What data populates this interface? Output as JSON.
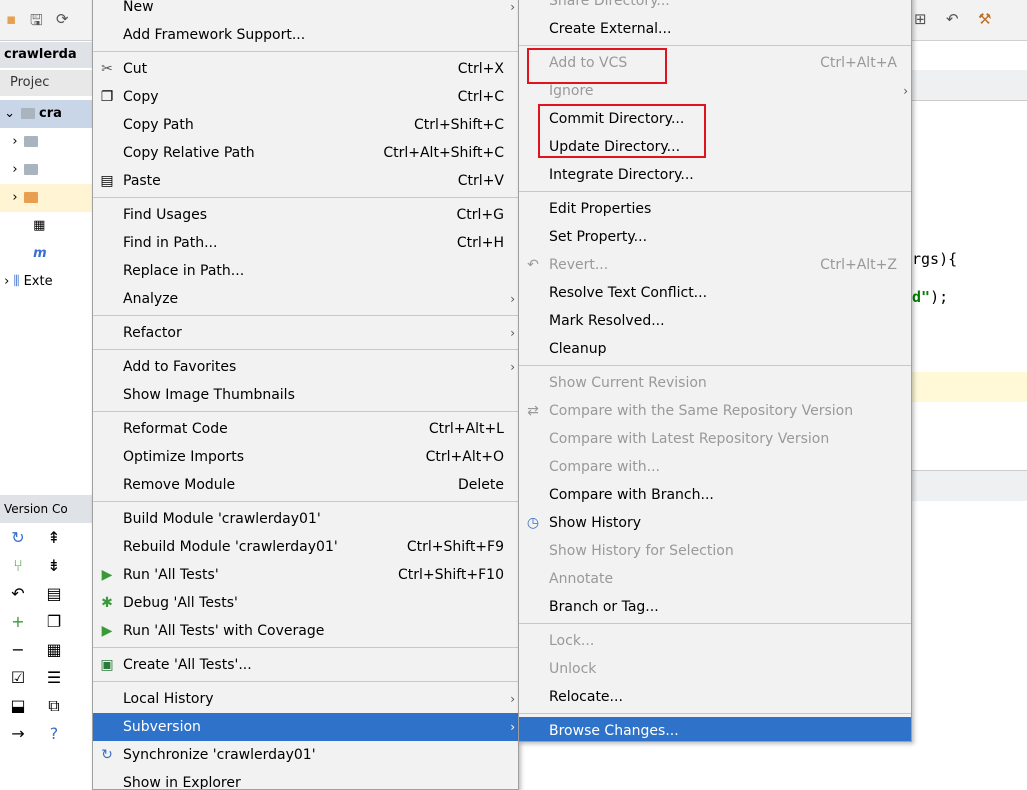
{
  "ide": {
    "project_title": "crawlerda",
    "project_tab": "Projec",
    "tree": [
      {
        "label": "cra",
        "type": "module"
      },
      {
        "label": "",
        "type": "folder"
      },
      {
        "label": "",
        "type": "folder"
      },
      {
        "label": "",
        "type": "folder-orange"
      },
      {
        "label": "",
        "type": "file"
      },
      {
        "label": "m",
        "type": "maven"
      },
      {
        "label": "Exte",
        "type": "libraries"
      }
    ],
    "code_line_1": "rgs){",
    "code_line_2_str": "d\"",
    "code_line_2_end": ");",
    "vc_title": "Version Co"
  },
  "menu1": {
    "items": [
      {
        "label": "New",
        "shortcut": "",
        "submenu": true,
        "icon": ""
      },
      {
        "label": "Add Framework Support...",
        "shortcut": "",
        "icon": ""
      },
      {
        "sep": true
      },
      {
        "label": "Cut",
        "shortcut": "Ctrl+X",
        "icon": "scissors-icon"
      },
      {
        "label": "Copy",
        "shortcut": "Ctrl+C",
        "icon": "copy-icon"
      },
      {
        "label": "Copy Path",
        "shortcut": "Ctrl+Shift+C",
        "icon": ""
      },
      {
        "label": "Copy Relative Path",
        "shortcut": "Ctrl+Alt+Shift+C",
        "icon": ""
      },
      {
        "label": "Paste",
        "shortcut": "Ctrl+V",
        "icon": "paste-icon"
      },
      {
        "sep": true
      },
      {
        "label": "Find Usages",
        "shortcut": "Ctrl+G",
        "icon": ""
      },
      {
        "label": "Find in Path...",
        "shortcut": "Ctrl+H",
        "icon": ""
      },
      {
        "label": "Replace in Path...",
        "shortcut": "",
        "icon": ""
      },
      {
        "label": "Analyze",
        "shortcut": "",
        "submenu": true,
        "icon": ""
      },
      {
        "sep": true
      },
      {
        "label": "Refactor",
        "shortcut": "",
        "submenu": true,
        "icon": ""
      },
      {
        "sep": true
      },
      {
        "label": "Add to Favorites",
        "shortcut": "",
        "submenu": true,
        "icon": ""
      },
      {
        "label": "Show Image Thumbnails",
        "shortcut": "",
        "icon": ""
      },
      {
        "sep": true
      },
      {
        "label": "Reformat Code",
        "shortcut": "Ctrl+Alt+L",
        "icon": ""
      },
      {
        "label": "Optimize Imports",
        "shortcut": "Ctrl+Alt+O",
        "icon": ""
      },
      {
        "label": "Remove Module",
        "shortcut": "Delete",
        "icon": ""
      },
      {
        "sep": true
      },
      {
        "label": "Build Module 'crawlerday01'",
        "shortcut": "",
        "icon": ""
      },
      {
        "label": "Rebuild Module 'crawlerday01'",
        "shortcut": "Ctrl+Shift+F9",
        "icon": ""
      },
      {
        "label": "Run 'All Tests'",
        "shortcut": "Ctrl+Shift+F10",
        "icon": "run-icon"
      },
      {
        "label": "Debug 'All Tests'",
        "shortcut": "",
        "icon": "debug-icon"
      },
      {
        "label": "Run 'All Tests' with Coverage",
        "shortcut": "",
        "icon": "coverage-icon"
      },
      {
        "sep": true
      },
      {
        "label": "Create 'All Tests'...",
        "shortcut": "",
        "icon": "create-test-icon"
      },
      {
        "sep": true
      },
      {
        "label": "Local History",
        "shortcut": "",
        "submenu": true,
        "icon": ""
      },
      {
        "label": "Subversion",
        "shortcut": "",
        "submenu": true,
        "icon": "",
        "highlighted": true
      },
      {
        "label": "Synchronize 'crawlerday01'",
        "shortcut": "",
        "icon": "sync-icon"
      },
      {
        "label": "Show in Explorer",
        "shortcut": "",
        "icon": ""
      }
    ]
  },
  "menu2": {
    "items": [
      {
        "label": "Share Directory...",
        "shortcut": "",
        "icon": ""
      },
      {
        "label": "Create External...",
        "shortcut": "",
        "icon": ""
      },
      {
        "sep": true
      },
      {
        "label": "Add to VCS",
        "shortcut": "Ctrl+Alt+A",
        "icon": "",
        "disabled": true
      },
      {
        "label": "Ignore",
        "shortcut": "",
        "submenu": true,
        "icon": "",
        "disabled": true
      },
      {
        "label": "Commit Directory...",
        "shortcut": "",
        "icon": ""
      },
      {
        "label": "Update Directory...",
        "shortcut": "",
        "icon": ""
      },
      {
        "label": "Integrate Directory...",
        "shortcut": "",
        "icon": ""
      },
      {
        "sep": true
      },
      {
        "label": "Edit Properties",
        "shortcut": "",
        "icon": ""
      },
      {
        "label": "Set Property...",
        "shortcut": "",
        "icon": ""
      },
      {
        "label": "Revert...",
        "shortcut": "Ctrl+Alt+Z",
        "icon": "revert-icon",
        "disabled": true
      },
      {
        "label": "Resolve Text Conflict...",
        "shortcut": "",
        "icon": ""
      },
      {
        "label": "Mark Resolved...",
        "shortcut": "",
        "icon": ""
      },
      {
        "label": "Cleanup",
        "shortcut": "",
        "icon": ""
      },
      {
        "sep": true
      },
      {
        "label": "Show Current Revision",
        "shortcut": "",
        "icon": "",
        "disabled": true
      },
      {
        "label": "Compare with the Same Repository Version",
        "shortcut": "",
        "icon": "compare-icon",
        "disabled": true
      },
      {
        "label": "Compare with Latest Repository Version",
        "shortcut": "",
        "icon": "",
        "disabled": true
      },
      {
        "label": "Compare with...",
        "shortcut": "",
        "icon": "",
        "disabled": true
      },
      {
        "label": "Compare with Branch...",
        "shortcut": "",
        "icon": ""
      },
      {
        "label": "Show History",
        "shortcut": "",
        "icon": "history-icon"
      },
      {
        "label": "Show History for Selection",
        "shortcut": "",
        "icon": "",
        "disabled": true
      },
      {
        "label": "Annotate",
        "shortcut": "",
        "icon": "",
        "disabled": true
      },
      {
        "label": "Branch or Tag...",
        "shortcut": "",
        "icon": ""
      },
      {
        "sep": true
      },
      {
        "label": "Lock...",
        "shortcut": "",
        "icon": "",
        "disabled": true
      },
      {
        "label": "Unlock",
        "shortcut": "",
        "icon": "",
        "disabled": true
      },
      {
        "label": "Relocate...",
        "shortcut": "",
        "icon": ""
      },
      {
        "sep": true
      },
      {
        "label": "Browse Changes...",
        "shortcut": "",
        "icon": "",
        "highlighted": true
      }
    ]
  },
  "colors": {
    "highlight": "#2e73c9",
    "annotation": "#e0141e"
  }
}
